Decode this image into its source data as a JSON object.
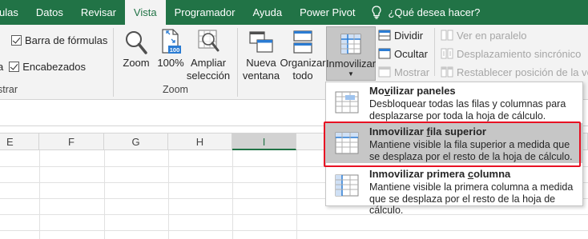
{
  "tabs": [
    {
      "label": "ulas",
      "active": false
    },
    {
      "label": "Datos",
      "active": false
    },
    {
      "label": "Revisar",
      "active": false
    },
    {
      "label": "Vista",
      "active": true
    },
    {
      "label": "Programador",
      "active": false
    },
    {
      "label": "Ayuda",
      "active": false
    },
    {
      "label": "Power Pivot",
      "active": false
    }
  ],
  "tell_me": {
    "icon": "lightbulb-icon",
    "label": "¿Qué desea hacer?"
  },
  "show_group": {
    "formula_bar_label": "Barra de fórmulas",
    "formula_bar_checked": true,
    "headings_label": "Encabezados",
    "headings_checked": true,
    "fragment_a": "a",
    "group_label": "strar"
  },
  "zoom_group": {
    "zoom_label": "Zoom",
    "hundred_label": "100%",
    "hundred_badge": "100",
    "selection_line1": "Ampliar",
    "selection_line2": "selección",
    "group_label": "Zoom"
  },
  "window_group": {
    "new_window_line1": "Nueva",
    "new_window_line2": "ventana",
    "arrange_line1": "Organizar",
    "arrange_line2": "todo",
    "freeze_label": "Inmovilizar",
    "split_label": "Dividir",
    "hide_label": "Ocultar",
    "unhide_label": "Mostrar",
    "side_by_side_label": "Ver en paralelo",
    "sync_scroll_label": "Desplazamiento sincrónico",
    "reset_position_label": "Restablecer posición de la venta"
  },
  "columns": [
    "E",
    "F",
    "G",
    "H",
    "I"
  ],
  "selected_column": "I",
  "freeze_menu": {
    "items": [
      {
        "title_pre": "Mo",
        "title_ul": "v",
        "title_post": "ilizar paneles",
        "desc": "Desbloquear todas las filas y columnas para desplazarse por toda la hoja de cálculo."
      },
      {
        "title_pre": "Inmovilizar ",
        "title_ul": "f",
        "title_post": "ila superior",
        "desc": "Mantiene visible la fila superior a medida que se desplaza por el resto de la hoja de cálculo.",
        "highlighted": true
      },
      {
        "title_pre": "Inmovilizar primera ",
        "title_ul": "c",
        "title_post": "olumna",
        "desc": "Mantiene visible la primera columna a medida que se desplaza por el resto de la hoja de cálculo."
      }
    ]
  },
  "colors": {
    "excel_green": "#217346",
    "highlight_box": "#e81123",
    "menu_hover": "#c6c6c6"
  }
}
